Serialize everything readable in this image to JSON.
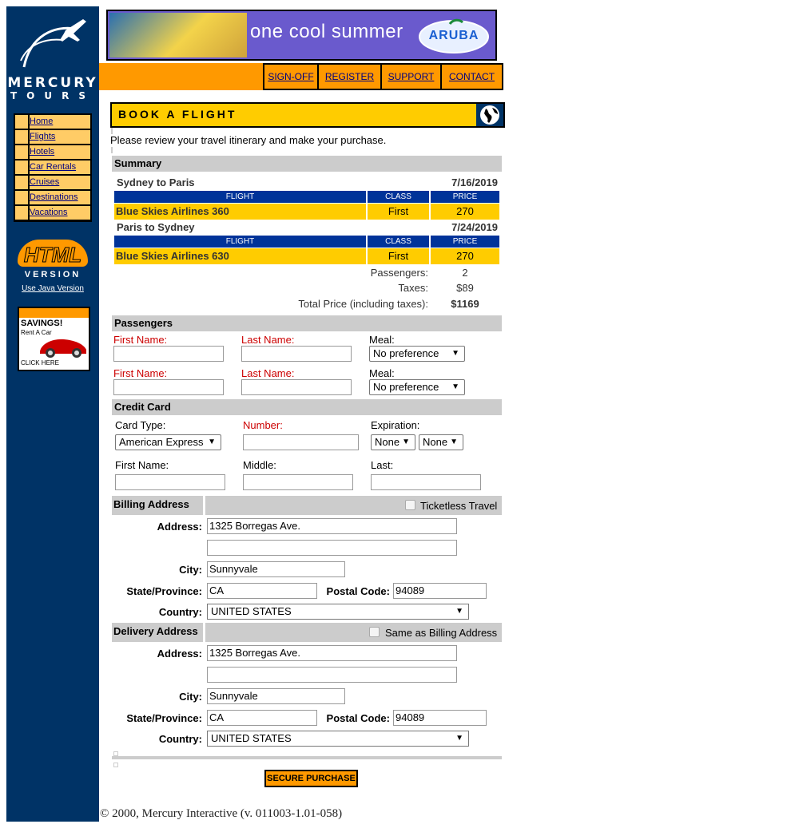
{
  "sidebar": {
    "logo_line1": "MERCURY",
    "logo_line2": "TOURS",
    "nav": [
      "Home",
      "Flights",
      "Hotels",
      "Car Rentals",
      "Cruises",
      "Destinations",
      "Vacations"
    ],
    "html_badge_line1": "HTML",
    "html_badge_line2": "VERSION",
    "java_link": "Use Java Version",
    "ad_title": "SAVINGS!",
    "ad_subtitle": "Rent A Car",
    "ad_cta": "CLICK HERE"
  },
  "banner": {
    "text": "one cool summer",
    "brand": "ARUBA"
  },
  "topnav": [
    "SIGN-OFF",
    "REGISTER",
    "SUPPORT",
    "CONTACT"
  ],
  "page": {
    "heading": "BOOK A FLIGHT",
    "intro": "Please review your travel itinerary and make your purchase."
  },
  "summary": {
    "header": "Summary",
    "columns": [
      "FLIGHT",
      "CLASS",
      "PRICE"
    ],
    "legs": [
      {
        "route": "Sydney to Paris",
        "date": "7/16/2019",
        "flight": "Blue Skies Airlines 360",
        "class": "First",
        "price": "270"
      },
      {
        "route": "Paris to Sydney",
        "date": "7/24/2019",
        "flight": "Blue Skies Airlines 630",
        "class": "First",
        "price": "270"
      }
    ],
    "passengers_label": "Passengers:",
    "passengers": "2",
    "taxes_label": "Taxes:",
    "taxes": "$89",
    "total_label": "Total Price (including taxes):",
    "total": "$1169"
  },
  "passengers": {
    "header": "Passengers",
    "first_label": "First Name:",
    "last_label": "Last Name:",
    "meal_label": "Meal:",
    "rows": [
      {
        "first": "",
        "last": "",
        "meal": "No preference"
      },
      {
        "first": "",
        "last": "",
        "meal": "No preference"
      }
    ]
  },
  "credit": {
    "header": "Credit Card",
    "card_type_label": "Card Type:",
    "card_type": "American Express",
    "number_label": "Number:",
    "number": "",
    "exp_label": "Expiration:",
    "exp_month": "None",
    "exp_year": "None",
    "first_label": "First Name:",
    "middle_label": "Middle:",
    "last_label": "Last:"
  },
  "billing": {
    "header": "Billing Address",
    "option": "Ticketless Travel",
    "address_label": "Address:",
    "address1": "1325 Borregas Ave.",
    "address2": "",
    "city_label": "City:",
    "city": "Sunnyvale",
    "state_label": "State/Province:",
    "state": "CA",
    "postal_label": "Postal Code:",
    "postal": "94089",
    "country_label": "Country:",
    "country": "UNITED STATES"
  },
  "delivery": {
    "header": "Delivery Address",
    "option": "Same as Billing Address",
    "address_label": "Address:",
    "address1": "1325 Borregas Ave.",
    "address2": "",
    "city_label": "City:",
    "city": "Sunnyvale",
    "state_label": "State/Province:",
    "state": "CA",
    "postal_label": "Postal Code:",
    "postal": "94089",
    "country_label": "Country:",
    "country": "UNITED STATES"
  },
  "actions": {
    "secure_purchase": "SECURE PURCHASE"
  },
  "footer": "© 2000, Mercury Interactive (v. 011003-1.01-058)",
  "colors": {
    "sidebar": "#003366",
    "accent": "#ff9900",
    "yellow": "#ffcc00",
    "table_header": "#003399"
  }
}
